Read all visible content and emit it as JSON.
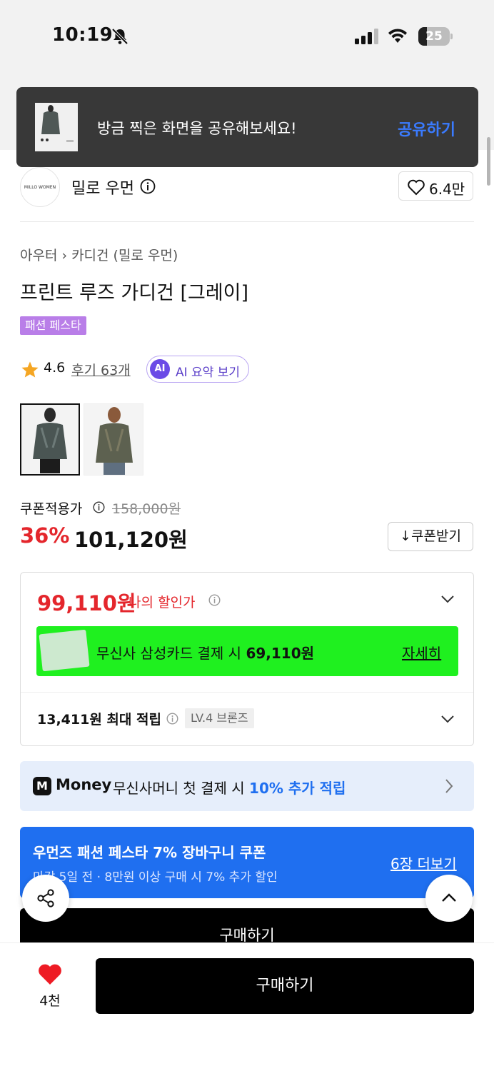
{
  "status_bar": {
    "time": "10:19",
    "battery": "25"
  },
  "toast": {
    "message": "방금 찍은 화면을 공유해보세요!",
    "action": "공유하기"
  },
  "brand": {
    "logo_text": "MILLO WOMEN",
    "name": "밀로 우먼",
    "likes": "6.4만"
  },
  "breadcrumb": {
    "category": "아우터",
    "subcategory": "카디건 (밀로 우먼)"
  },
  "product": {
    "title": "프린트 루즈 가디건 [그레이]",
    "badge": "패션 페스타"
  },
  "rating": {
    "score": "4.6",
    "reviews": "후기 63개",
    "ai_badge": "AI",
    "ai_label": "AI 요약 보기"
  },
  "pricing": {
    "coupon_label": "쿠폰적용가",
    "original_price": "158,000원",
    "discount": "36%",
    "price": "101,120원",
    "coupon_button": "쿠폰받기"
  },
  "benefits": {
    "my_price": "99,110원",
    "my_price_label": "나의 할인가",
    "card_text_prefix": "무신사 삼성카드 결제 시",
    "card_price": "69,110원",
    "card_more": "자세히",
    "points": "13,411원 최대 적립",
    "level": "LV.4 브론즈"
  },
  "money_banner": {
    "logo": "M",
    "brand": "Money",
    "text": "무신사머니 첫 결제 시",
    "highlight": "10% 추가 적립"
  },
  "coupon_banner": {
    "title": "우먼즈 패션 페스타 7% 장바구니 쿠폰",
    "subtitle": "마감 5일 전 · 8만원 이상 구매 시 7% 추가 할인",
    "more": "6장 더보기"
  },
  "bottom_bar": {
    "like_count": "4천",
    "buy_label": "구매하기",
    "buy_behind_label": "구매하기"
  },
  "colors": {
    "accent_red": "#e4262c",
    "accent_blue": "#1f6ff0",
    "card_green": "#1ff01f",
    "festa_purple": "#b97ee8"
  }
}
